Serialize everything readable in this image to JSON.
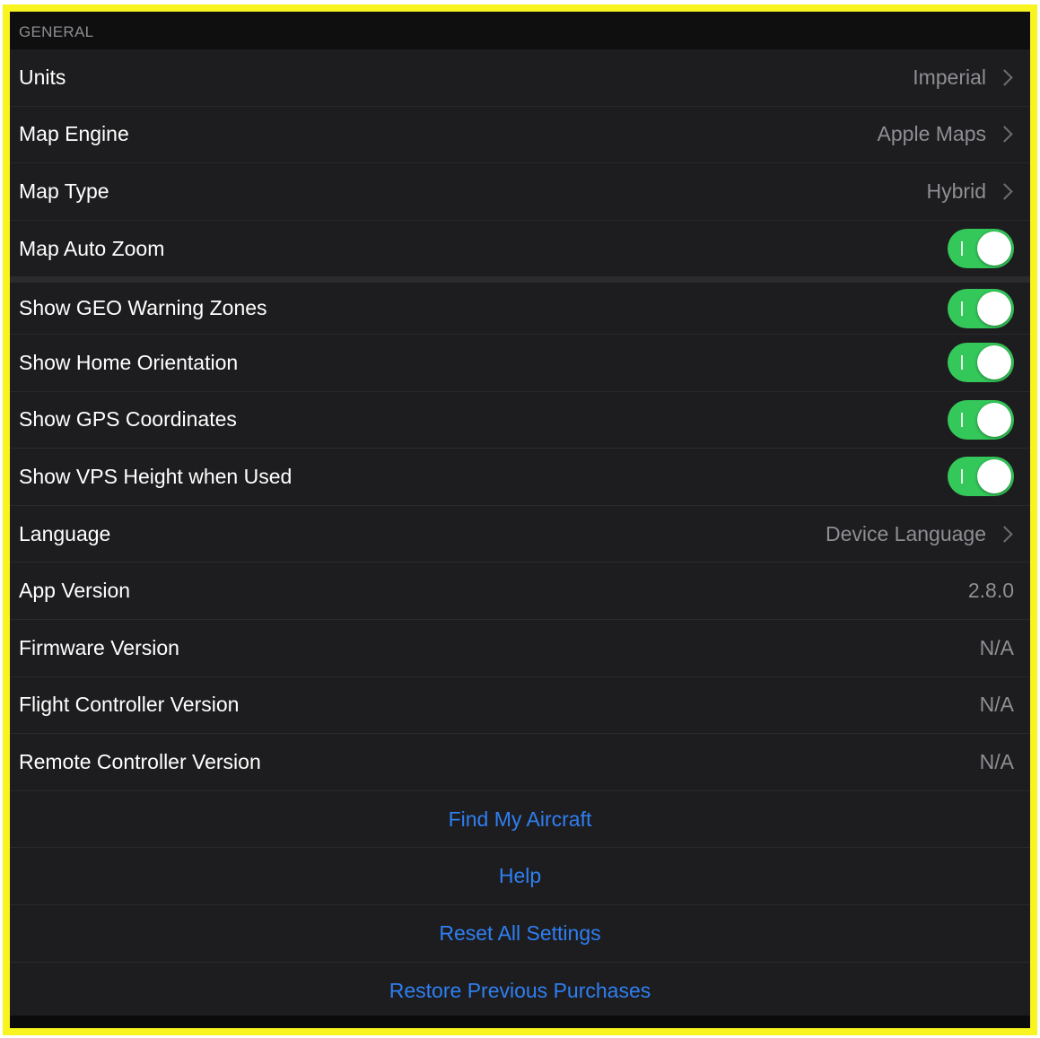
{
  "section": {
    "title": "GENERAL"
  },
  "rows": [
    {
      "label": "Units",
      "value": "Imperial",
      "type": "disclosure"
    },
    {
      "label": "Map Engine",
      "value": "Apple Maps",
      "type": "disclosure"
    },
    {
      "label": "Map Type",
      "value": "Hybrid",
      "type": "disclosure"
    },
    {
      "label": "Map Auto Zoom",
      "type": "toggle",
      "on": true
    },
    {
      "label": "Show GEO Warning Zones",
      "type": "toggle",
      "on": true
    },
    {
      "label": "Show Home Orientation",
      "type": "toggle",
      "on": true
    },
    {
      "label": "Show GPS Coordinates",
      "type": "toggle",
      "on": true
    },
    {
      "label": "Show VPS Height when Used",
      "type": "toggle",
      "on": true
    },
    {
      "label": "Language",
      "value": "Device Language",
      "type": "disclosure"
    },
    {
      "label": "App Version",
      "value": "2.8.0",
      "type": "info"
    },
    {
      "label": "Firmware Version",
      "value": "N/A",
      "type": "info"
    },
    {
      "label": "Flight Controller Version",
      "value": "N/A",
      "type": "info"
    },
    {
      "label": "Remote Controller Version",
      "value": "N/A",
      "type": "info"
    }
  ],
  "actions": [
    {
      "label": "Find My Aircraft"
    },
    {
      "label": "Help"
    },
    {
      "label": "Reset All Settings"
    },
    {
      "label": "Restore Previous Purchases"
    }
  ],
  "colors": {
    "highlight_border": "#f7f41f",
    "toggle_on": "#34c759",
    "action_text": "#2f7ff2",
    "background": "#1d1d1f"
  },
  "icons": {
    "disclosure": "chevron-right-icon"
  }
}
